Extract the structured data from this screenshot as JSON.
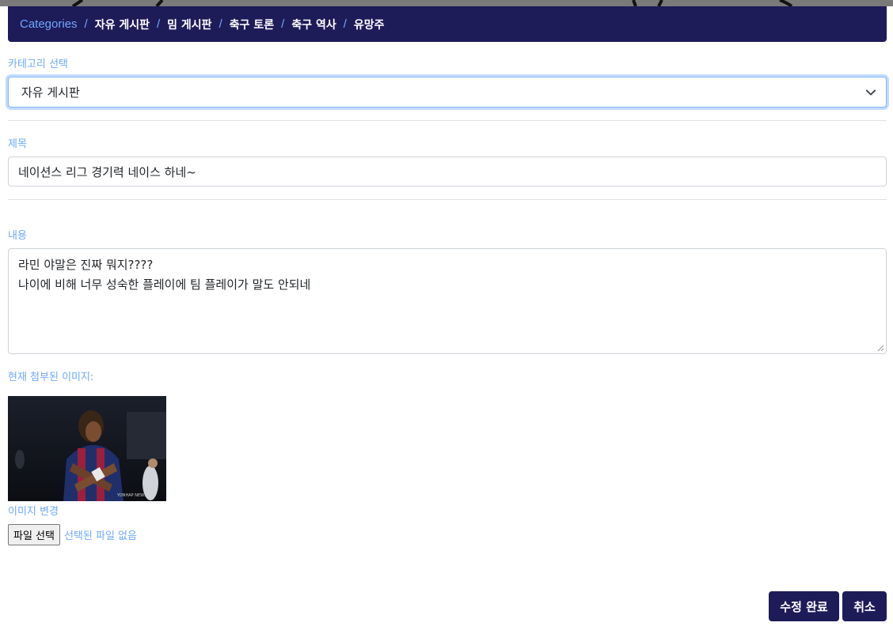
{
  "breadcrumb": {
    "items": [
      "Categories",
      "자유 게시판",
      "밈 게시판",
      "축구 토론",
      "축구 역사",
      "유망주"
    ],
    "separator": "/"
  },
  "category": {
    "label": "카테고리 선택",
    "selected": "자유 게시판"
  },
  "title_field": {
    "label": "제목",
    "value": "네이션스 리그 경기력 네이스 하네~"
  },
  "content_field": {
    "label": "내용",
    "lines": [
      "라민 야말은 진짜 뭐지????",
      "나이에 비해 너무 성숙한 플레이에 팀 플레이가 말도 안되네"
    ]
  },
  "image_section": {
    "current_label": "현재 첨부된 이미지:",
    "watermark": "YONHAP NEWS",
    "change_label": "이미지 변경",
    "file_button_label": "파일 선택",
    "file_status": "선택된 파일 없음"
  },
  "actions": {
    "save_label": "수정 완료",
    "cancel_label": "취소"
  },
  "colors": {
    "navbar": "#1e1b59",
    "accent": "#6ea8fe",
    "button": "#1e1b59"
  }
}
